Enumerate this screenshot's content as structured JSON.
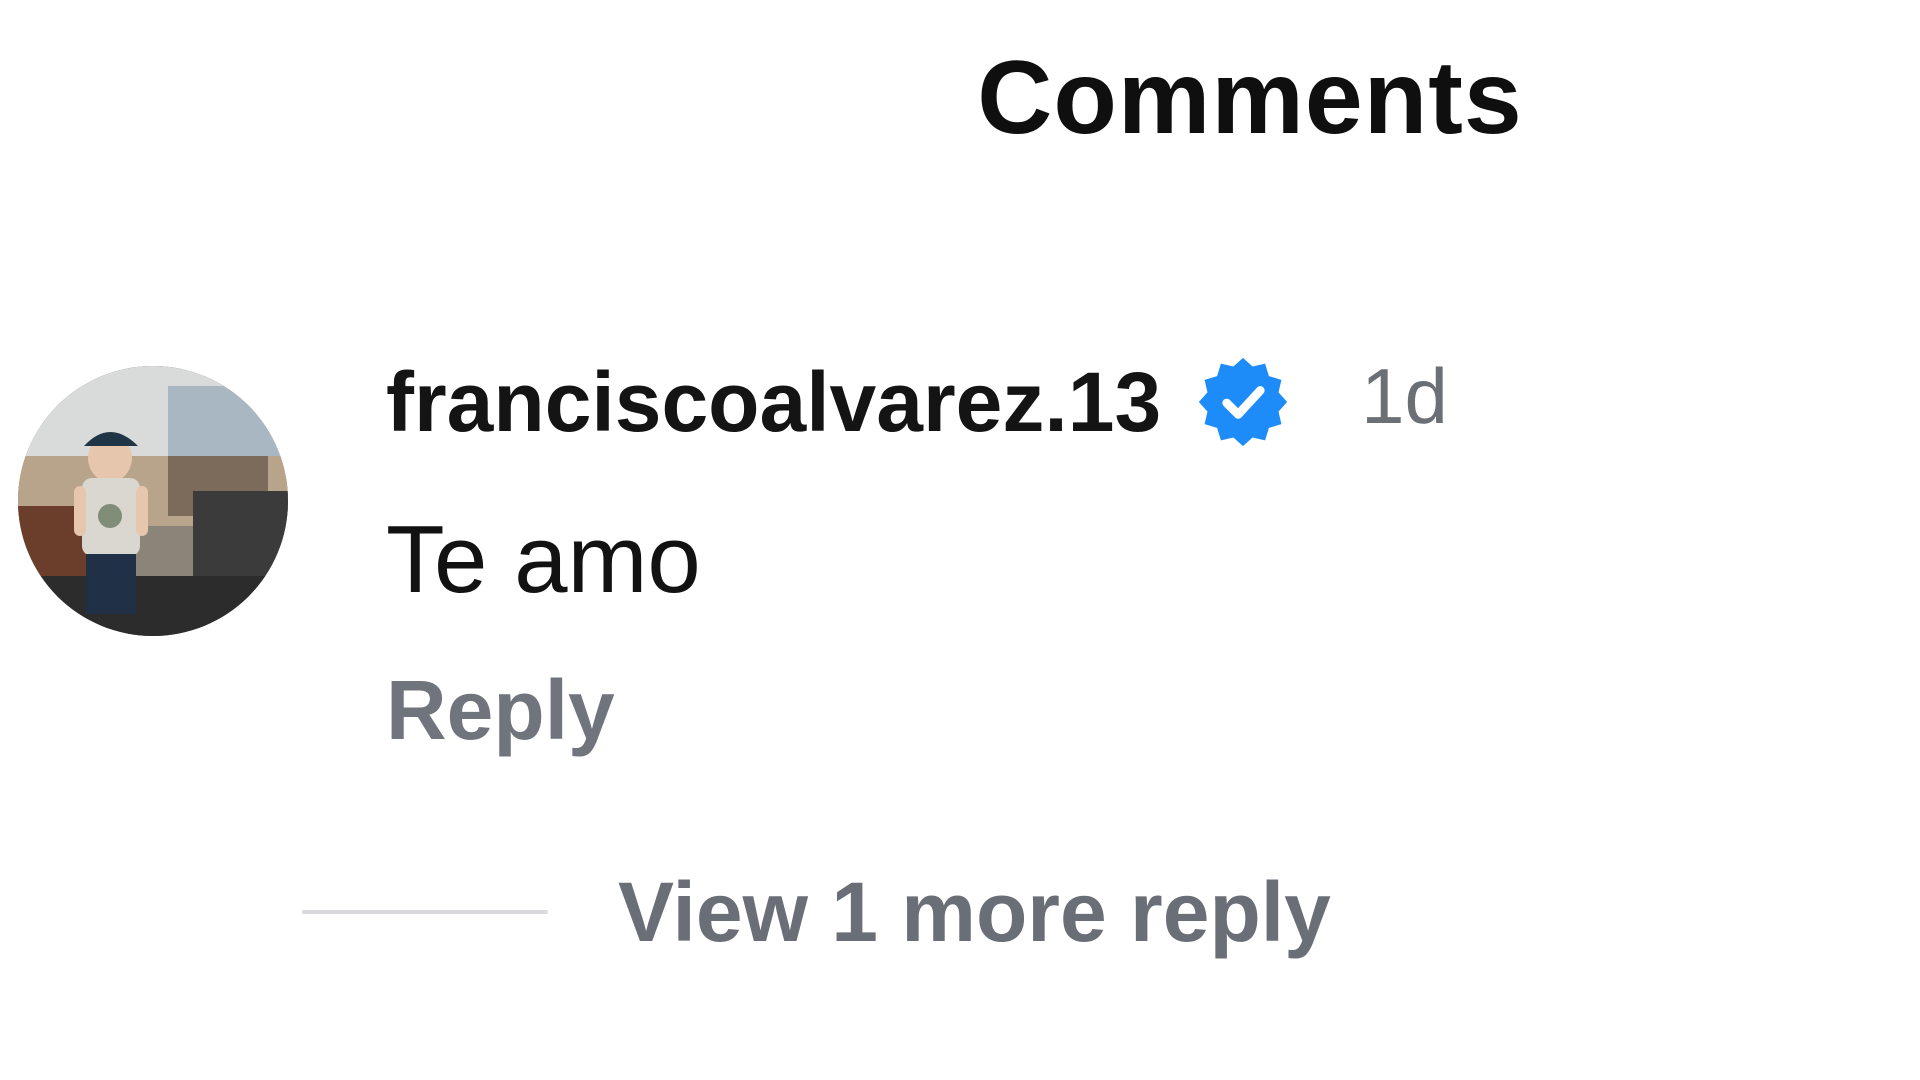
{
  "header": {
    "title": "Comments"
  },
  "comment": {
    "avatar_icon": "user-avatar-photo",
    "username": "franciscoalvarez.13",
    "verified_icon": "verified-badge-icon",
    "verified_color": "#1d8cf8",
    "timestamp": "1d",
    "text": "Te amo",
    "reply_label": "Reply",
    "view_more_replies_label": "View 1 more reply"
  },
  "colors": {
    "background": "#ffffff",
    "primary_text": "#111111",
    "secondary_text": "#6b6f76",
    "divider": "#d9dadd"
  }
}
